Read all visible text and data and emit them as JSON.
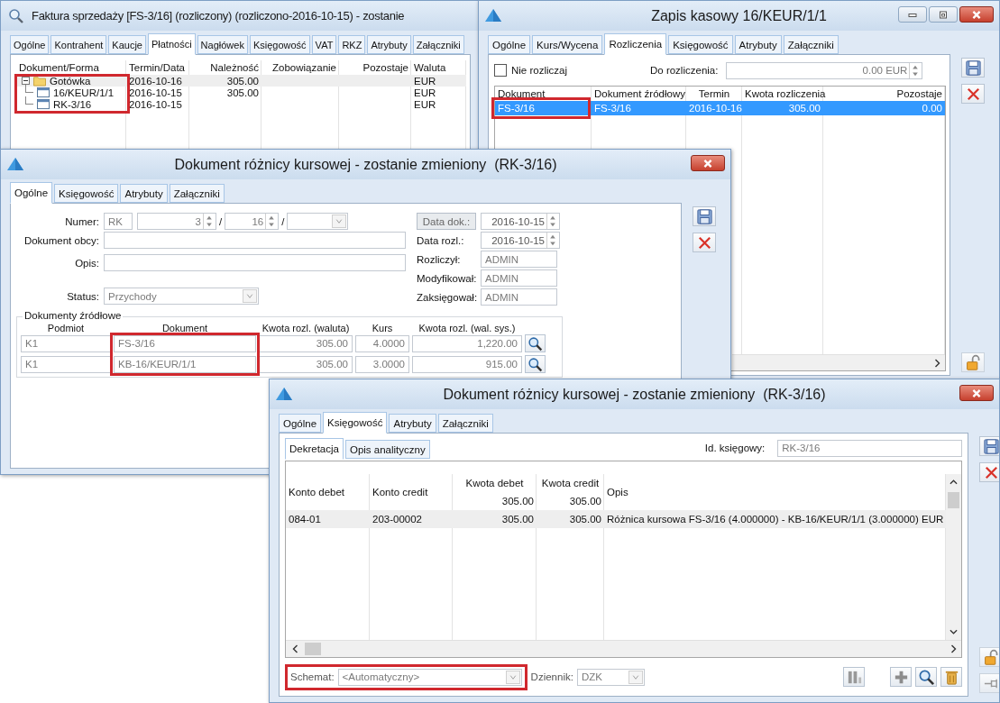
{
  "invoice_window": {
    "title": "Faktura sprzedaży [FS-3/16] (rozliczony) (rozliczono-2016-10-15) - zostanie",
    "tabs": [
      {
        "label": "Ogólne",
        "selected": false
      },
      {
        "label": "Kontrahent",
        "selected": false
      },
      {
        "label": "Kaucje",
        "selected": false
      },
      {
        "label": "Płatności",
        "selected": true
      },
      {
        "label": "Nagłówek",
        "selected": false
      },
      {
        "label": "Księgowość",
        "selected": false
      },
      {
        "label": "VAT",
        "selected": false
      },
      {
        "label": "RKZ",
        "selected": false
      },
      {
        "label": "Atrybuty",
        "selected": false
      },
      {
        "label": "Załączniki",
        "selected": false
      }
    ],
    "table": {
      "columns": [
        "Dokument/Forma",
        "Termin/Data",
        "Należność",
        "Zobowiązanie",
        "Pozostaje",
        "Waluta"
      ],
      "rows": [
        {
          "name": "Gotówka",
          "kind": "folder",
          "expanded": true,
          "selected": true,
          "date": "2016-10-16",
          "receivable": "305.00",
          "currency": "EUR",
          "children": [
            {
              "name": "16/KEUR/1/1",
              "kind": "document",
              "selected": false,
              "date": "2016-10-15",
              "receivable": "305.00",
              "currency": "EUR"
            },
            {
              "name": "RK-3/16",
              "kind": "document",
              "selected": false,
              "date": "2016-10-15",
              "currency": "EUR"
            }
          ]
        }
      ]
    }
  },
  "cash_window": {
    "title": "Zapis kasowy 16/KEUR/1/1",
    "tabs": [
      {
        "label": "Ogólne",
        "selected": false
      },
      {
        "label": "Kurs/Wycena",
        "selected": false
      },
      {
        "label": "Rozliczenia",
        "selected": true
      },
      {
        "label": "Księgowość",
        "selected": false
      },
      {
        "label": "Atrybuty",
        "selected": false
      },
      {
        "label": "Załączniki",
        "selected": false
      }
    ],
    "no_settle": {
      "label": "Nie rozliczaj",
      "checked": false
    },
    "to_settle": {
      "label": "Do rozliczenia:",
      "value": "0.00 EUR"
    },
    "table": {
      "columns": [
        "Dokument",
        "Dokument źródłowy",
        "Termin",
        "Kwota rozliczenia",
        "Pozostaje"
      ],
      "rows": [
        {
          "selected": true,
          "cells": [
            "FS-3/16",
            "FS-3/16",
            "2016-10-16",
            "305.00",
            "0.00"
          ]
        }
      ]
    }
  },
  "rate_diff_window": {
    "title": "Dokument różnicy kursowej - zostanie zmieniony  (RK-3/16)",
    "tabs": [
      {
        "label": "Ogólne",
        "selected": true
      },
      {
        "label": "Księgowość",
        "selected": false
      },
      {
        "label": "Atrybuty",
        "selected": false
      },
      {
        "label": "Załączniki",
        "selected": false
      }
    ],
    "number": {
      "label": "Numer:",
      "series": "RK",
      "number": "3",
      "separators": [
        "/",
        "/"
      ],
      "year": "16"
    },
    "foreign_doc": {
      "label": "Dokument obcy:"
    },
    "description": {
      "label": "Opis:"
    },
    "status": {
      "label": "Status:",
      "value": "Przychody"
    },
    "doc_date": {
      "label": "Data dok.:",
      "value": "2016-10-15"
    },
    "settle_date": {
      "label": "Data rozl.:",
      "value": "2016-10-15"
    },
    "people": [
      {
        "label": "Rozliczył:",
        "value": "ADMIN"
      },
      {
        "label": "Modyfikował:",
        "value": "ADMIN"
      },
      {
        "label": "Zaksięgował:",
        "value": "ADMIN"
      }
    ],
    "sources": {
      "title": "Dokumenty źródłowe",
      "columns": [
        "Podmiot",
        "Dokument",
        "Kwota rozl. (waluta)",
        "Kurs",
        "Kwota rozl. (wal. sys.)"
      ],
      "rows": [
        {
          "cells": [
            "K1",
            "FS-3/16",
            "305.00",
            "4.0000",
            "1,220.00"
          ]
        },
        {
          "cells": [
            "K1",
            "KB-16/KEUR/1/1",
            "305.00",
            "3.0000",
            "915.00"
          ]
        }
      ]
    }
  },
  "accounting_window": {
    "title": "Dokument różnicy kursowej - zostanie zmieniony  (RK-3/16)",
    "tabs": [
      {
        "label": "Ogólne",
        "selected": false
      },
      {
        "label": "Księgowość",
        "selected": true
      },
      {
        "label": "Atrybuty",
        "selected": false
      },
      {
        "label": "Załączniki",
        "selected": false
      }
    ],
    "subtabs": [
      {
        "label": "Dekretacja",
        "selected": true
      },
      {
        "label": "Opis analityczny",
        "selected": false
      }
    ],
    "accounting_id": {
      "label": "Id. księgowy:",
      "value": "RK-3/16"
    },
    "table": {
      "columns": [
        {
          "label": "Konto debet"
        },
        {
          "label": "Konto credit"
        },
        {
          "label": "Kwota debet",
          "total": "305.00"
        },
        {
          "label": "Kwota credit",
          "total": "305.00"
        },
        {
          "label": "Opis"
        }
      ],
      "rows": [
        {
          "selected": true,
          "cells": [
            "084-01",
            "203-00002",
            "305.00",
            "305.00",
            "Różnica kursowa FS-3/16 (4.000000) - KB-16/KEUR/1/1 (3.000000) EUR"
          ]
        }
      ]
    },
    "schema": {
      "label": "Schemat:",
      "value": "<Automatyczny>"
    },
    "journal": {
      "label": "Dziennik:",
      "value": "DZK"
    }
  }
}
